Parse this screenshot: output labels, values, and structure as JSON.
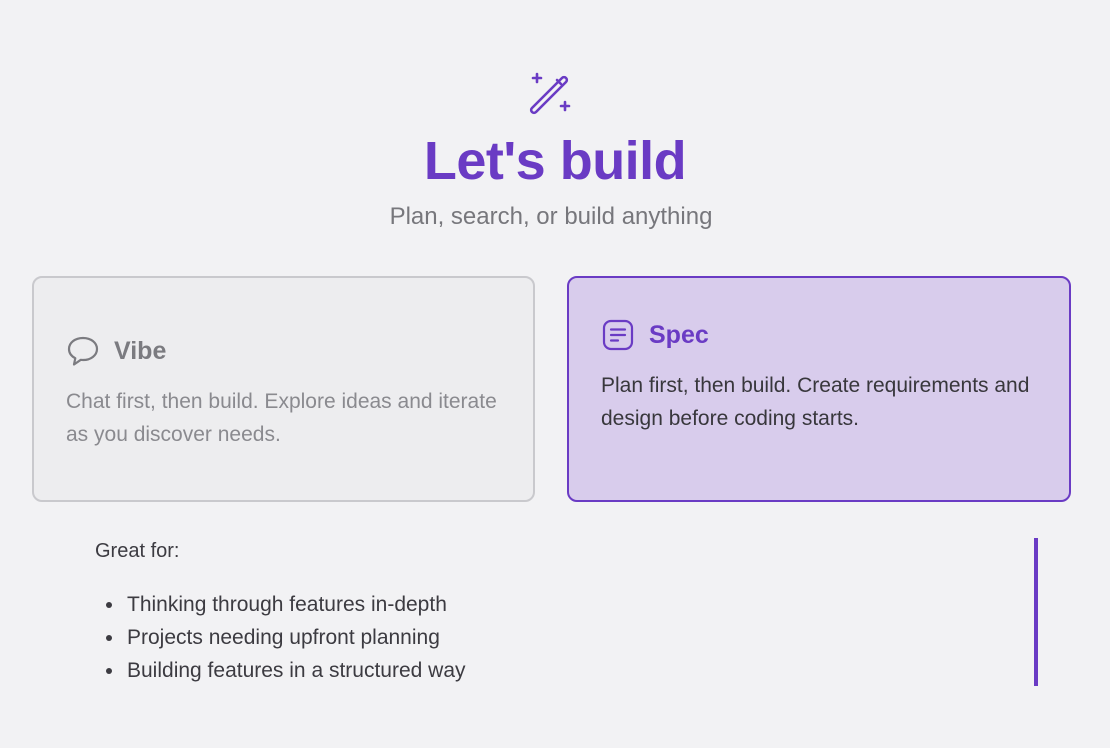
{
  "header": {
    "icon": "magic-wand-icon",
    "title": "Let's build",
    "subtitle": "Plan, search, or build anything"
  },
  "modes": [
    {
      "id": "vibe",
      "icon": "chat-bubble-icon",
      "name": "Vibe",
      "description": "Chat first, then build. Explore ideas and iterate as you discover needs.",
      "selected": false
    },
    {
      "id": "spec",
      "icon": "document-lines-icon",
      "name": "Spec",
      "description": "Plan first, then build. Create requirements and design before coding starts.",
      "selected": true
    }
  ],
  "details": {
    "label": "Great for:",
    "items": [
      "Thinking through features in-depth",
      "Projects needing upfront planning",
      "Building features in a structured way"
    ]
  },
  "colors": {
    "accent": "#6a3bc4",
    "accent_light": "#d8ccec",
    "background": "#f2f2f4",
    "muted_text": "#77777c"
  }
}
